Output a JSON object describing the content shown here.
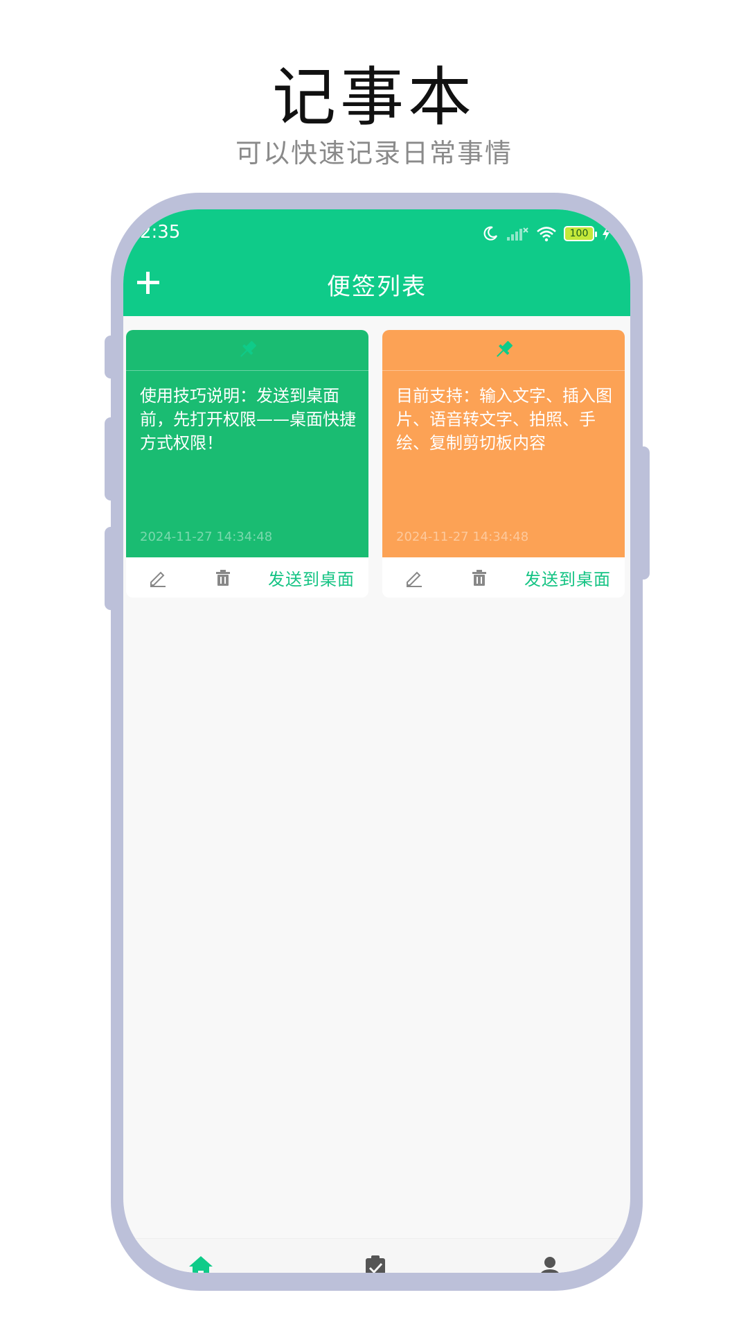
{
  "promo": {
    "title": "记事本",
    "subtitle": "可以快速记录日常事情"
  },
  "status_bar": {
    "time": "2:35",
    "battery": "100",
    "icons": [
      "moon-icon",
      "signal-icon",
      "wifi-icon",
      "battery-icon",
      "charging-icon"
    ]
  },
  "header": {
    "title": "便签列表",
    "add_icon": "plus-icon"
  },
  "notes": [
    {
      "text": "使用技巧说明：发送到桌面前，先打开权限——桌面快捷方式权限！",
      "date": "2024-11-27 14:34:48",
      "color": "#1abc72",
      "send_label": "发送到桌面"
    },
    {
      "text": "目前支持：输入文字、插入图片、语音转文字、拍照、手绘、复制剪切板内容",
      "date": "2024-11-27 14:34:48",
      "color": "#fca255",
      "send_label": "发送到桌面"
    }
  ],
  "bottom_nav": {
    "items": [
      "home-icon",
      "clipboard-check-icon",
      "person-icon"
    ],
    "active_color": "#0fcb89"
  },
  "colors": {
    "accent": "#0fcb89",
    "frame": "#bcc0d9"
  }
}
